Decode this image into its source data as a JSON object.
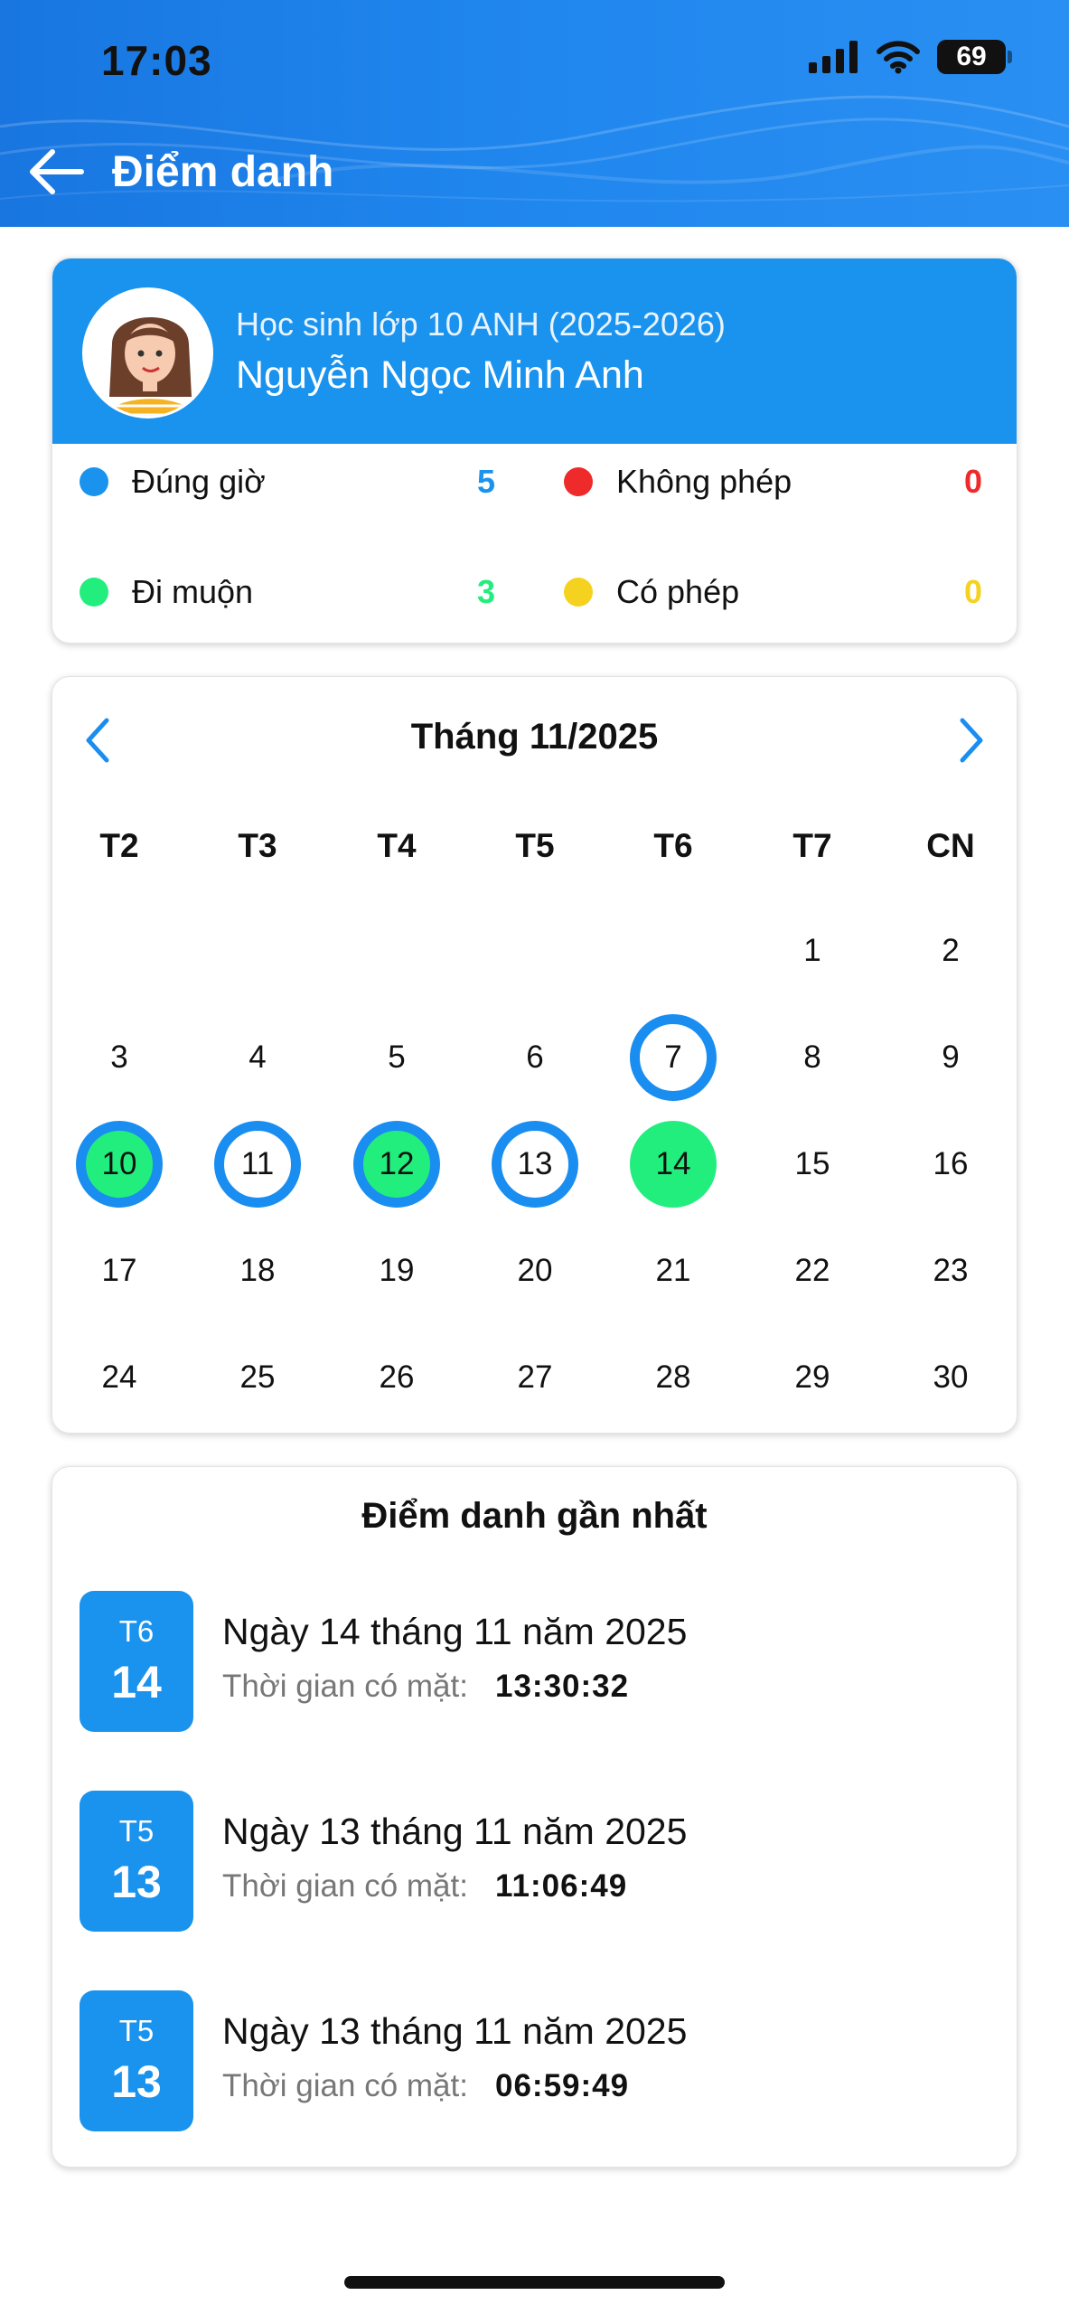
{
  "status_bar": {
    "time": "17:03",
    "battery": "69"
  },
  "header": {
    "title": "Điểm danh"
  },
  "student": {
    "class_line": "Học sinh lớp 10 ANH (2025-2026)",
    "name": "Nguyễn Ngọc Minh Anh"
  },
  "stats": [
    {
      "label": "Đúng giờ",
      "count": "5",
      "color": "#1a93ee"
    },
    {
      "label": "Không phép",
      "count": "0",
      "color": "#ee2a2a"
    },
    {
      "label": "Đi muộn",
      "count": "3",
      "color": "#22ee7e"
    },
    {
      "label": "Có phép",
      "count": "0",
      "color": "#f5d21f"
    }
  ],
  "calendar": {
    "title": "Tháng 11/2025",
    "weekdays": [
      "T2",
      "T3",
      "T4",
      "T5",
      "T6",
      "T7",
      "CN"
    ],
    "days": [
      "1",
      "2",
      "3",
      "4",
      "5",
      "6",
      "7",
      "8",
      "9",
      "10",
      "11",
      "12",
      "13",
      "14",
      "15",
      "16",
      "17",
      "18",
      "19",
      "20",
      "21",
      "22",
      "23",
      "24",
      "25",
      "26",
      "27",
      "28",
      "29",
      "30"
    ],
    "on_time_days": [
      "7",
      "10",
      "11",
      "12",
      "13"
    ],
    "late_days": [
      "10",
      "12",
      "14"
    ]
  },
  "recent": {
    "title": "Điểm danh gần nhất",
    "time_label": "Thời gian có mặt:",
    "items": [
      {
        "weekday": "T6",
        "day": "14",
        "date": "Ngày 14 tháng 11 năm 2025",
        "time": "13:30:32"
      },
      {
        "weekday": "T5",
        "day": "13",
        "date": "Ngày 13 tháng 11 năm 2025",
        "time": "11:06:49"
      },
      {
        "weekday": "T5",
        "day": "13",
        "date": "Ngày 13 tháng 11 năm 2025",
        "time": "06:59:49"
      }
    ]
  },
  "colors": {
    "primary": "#1a93ee",
    "late": "#22ee7e",
    "absent": "#ee2a2a",
    "excused": "#f5d21f"
  }
}
